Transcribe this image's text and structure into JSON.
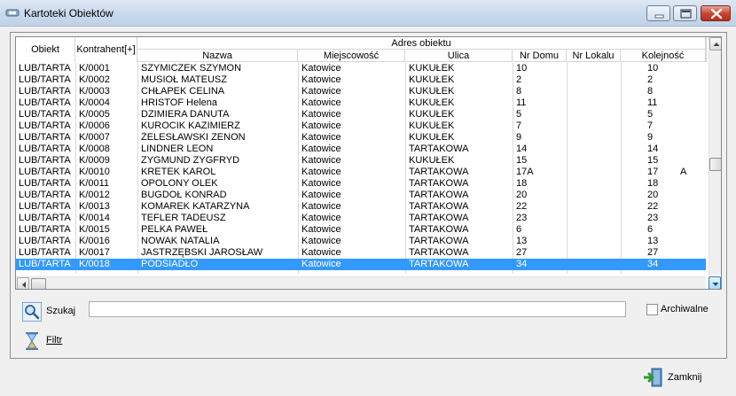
{
  "window": {
    "title": "Kartoteki Obiektów"
  },
  "grid": {
    "group_header": "Adres obiektu",
    "columns": {
      "obiekt": "Obiekt",
      "kontrahent": "Kontrahent[+]",
      "nazwa": "Nazwa",
      "miejscowosc": "Miejscowość",
      "ulica": "Ulica",
      "nr_domu": "Nr Domu",
      "nr_lokalu": "Nr Lokalu",
      "kolejnosc": "Kolejność"
    },
    "rows": [
      {
        "obiekt": "LUB/TARTA",
        "kontrahent": "K/0001",
        "nazwa": "SZYMICZEK SZYMON",
        "miejscowosc": "Katowice",
        "ulica": "KUKUŁEK",
        "nr_domu": "10",
        "nr_lokalu": "",
        "kolejnosc": "10",
        "extra": ""
      },
      {
        "obiekt": "LUB/TARTA",
        "kontrahent": "K/0002",
        "nazwa": "MUSIOŁ MATEUSZ",
        "miejscowosc": "Katowice",
        "ulica": "KUKUŁEK",
        "nr_domu": "2",
        "nr_lokalu": "",
        "kolejnosc": "2",
        "extra": ""
      },
      {
        "obiekt": "LUB/TARTA",
        "kontrahent": "K/0003",
        "nazwa": "CHŁAPEK CELINA",
        "miejscowosc": "Katowice",
        "ulica": "KUKUŁEK",
        "nr_domu": "8",
        "nr_lokalu": "",
        "kolejnosc": "8",
        "extra": ""
      },
      {
        "obiekt": "LUB/TARTA",
        "kontrahent": "K/0004",
        "nazwa": "HRISTOF Helena",
        "miejscowosc": "Katowice",
        "ulica": "KUKUŁEK",
        "nr_domu": "11",
        "nr_lokalu": "",
        "kolejnosc": "11",
        "extra": ""
      },
      {
        "obiekt": "LUB/TARTA",
        "kontrahent": "K/0005",
        "nazwa": "DZIMIERA DANUTA",
        "miejscowosc": "Katowice",
        "ulica": "KUKUŁEK",
        "nr_domu": "5",
        "nr_lokalu": "",
        "kolejnosc": "5",
        "extra": ""
      },
      {
        "obiekt": "LUB/TARTA",
        "kontrahent": "K/0006",
        "nazwa": "KUROCIK KAZIMIERZ",
        "miejscowosc": "Katowice",
        "ulica": "KUKUŁEK",
        "nr_domu": "7",
        "nr_lokalu": "",
        "kolejnosc": "7",
        "extra": ""
      },
      {
        "obiekt": "LUB/TARTA",
        "kontrahent": "K/0007",
        "nazwa": "ŻELESŁAWSKI ZENON",
        "miejscowosc": "Katowice",
        "ulica": "KUKUŁEK",
        "nr_domu": "9",
        "nr_lokalu": "",
        "kolejnosc": "9",
        "extra": ""
      },
      {
        "obiekt": "LUB/TARTA",
        "kontrahent": "K/0008",
        "nazwa": "LINDNER LEON",
        "miejscowosc": "Katowice",
        "ulica": "TARTAKOWA",
        "nr_domu": "14",
        "nr_lokalu": "",
        "kolejnosc": "14",
        "extra": ""
      },
      {
        "obiekt": "LUB/TARTA",
        "kontrahent": "K/0009",
        "nazwa": "ZYGMUND ZYGFRYD",
        "miejscowosc": "Katowice",
        "ulica": "KUKUŁEK",
        "nr_domu": "15",
        "nr_lokalu": "",
        "kolejnosc": "15",
        "extra": ""
      },
      {
        "obiekt": "LUB/TARTA",
        "kontrahent": "K/0010",
        "nazwa": "KRETEK KAROL",
        "miejscowosc": "Katowice",
        "ulica": "TARTAKOWA",
        "nr_domu": "17A",
        "nr_lokalu": "",
        "kolejnosc": "17",
        "extra": "A"
      },
      {
        "obiekt": "LUB/TARTA",
        "kontrahent": "K/0011",
        "nazwa": "OPOLONY OLEK",
        "miejscowosc": "Katowice",
        "ulica": "TARTAKOWA",
        "nr_domu": "18",
        "nr_lokalu": "",
        "kolejnosc": "18",
        "extra": ""
      },
      {
        "obiekt": "LUB/TARTA",
        "kontrahent": "K/0012",
        "nazwa": "BUGDOŁ KONRAD",
        "miejscowosc": "Katowice",
        "ulica": "TARTAKOWA",
        "nr_domu": "20",
        "nr_lokalu": "",
        "kolejnosc": "20",
        "extra": ""
      },
      {
        "obiekt": "LUB/TARTA",
        "kontrahent": "K/0013",
        "nazwa": "KOMAREK KATARZYNA",
        "miejscowosc": "Katowice",
        "ulica": "TARTAKOWA",
        "nr_domu": "22",
        "nr_lokalu": "",
        "kolejnosc": "22",
        "extra": ""
      },
      {
        "obiekt": "LUB/TARTA",
        "kontrahent": "K/0014",
        "nazwa": "TEFLER TADEUSZ",
        "miejscowosc": "Katowice",
        "ulica": "TARTAKOWA",
        "nr_domu": "23",
        "nr_lokalu": "",
        "kolejnosc": "23",
        "extra": ""
      },
      {
        "obiekt": "LUB/TARTA",
        "kontrahent": "K/0015",
        "nazwa": "PELKA PAWEŁ",
        "miejscowosc": "Katowice",
        "ulica": "TARTAKOWA",
        "nr_domu": "6",
        "nr_lokalu": "",
        "kolejnosc": "6",
        "extra": ""
      },
      {
        "obiekt": "LUB/TARTA",
        "kontrahent": "K/0016",
        "nazwa": "NOWAK NATALIA",
        "miejscowosc": "Katowice",
        "ulica": "TARTAKOWA",
        "nr_domu": "13",
        "nr_lokalu": "",
        "kolejnosc": "13",
        "extra": ""
      },
      {
        "obiekt": "LUB/TARTA",
        "kontrahent": "K/0017",
        "nazwa": "JASTRZĘBSKI JAROSŁAW",
        "miejscowosc": "Katowice",
        "ulica": "TARTAKOWA",
        "nr_domu": "27",
        "nr_lokalu": "",
        "kolejnosc": "27",
        "extra": ""
      },
      {
        "obiekt": "LUB/TARTA",
        "kontrahent": "K/0018",
        "nazwa": "PODSIADŁO",
        "miejscowosc": "Katowice",
        "ulica": "TARTAKOWA",
        "nr_domu": "34",
        "nr_lokalu": "",
        "kolejnosc": "34",
        "extra": "",
        "selected": true
      }
    ]
  },
  "search": {
    "label": "Szukaj",
    "value": ""
  },
  "archive": {
    "label": "Archiwalne",
    "checked": false
  },
  "filter": {
    "label": "Filtr"
  },
  "close": {
    "label": "Zamknij"
  },
  "icons": {
    "app": "app-icon",
    "search": "magnifier-icon",
    "filter": "hourglass-icon",
    "close": "exit-door-icon"
  },
  "colors": {
    "selection": "#3399ff",
    "close_button": "#c7432f"
  }
}
